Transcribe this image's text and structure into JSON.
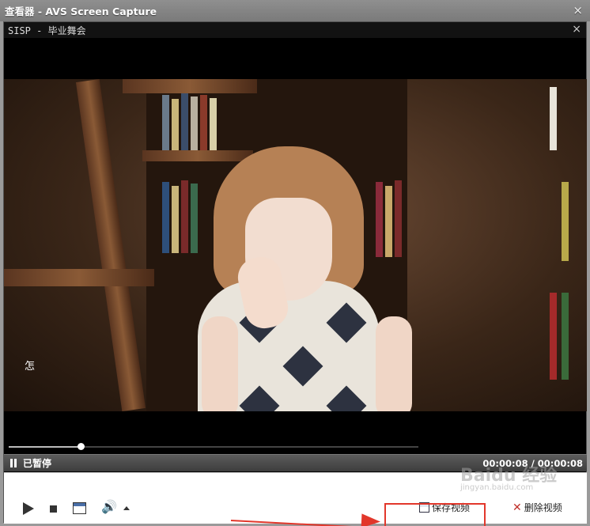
{
  "window": {
    "title": "查看器 - AVS Screen Capture",
    "close_glyph": "×"
  },
  "viewer": {
    "title": "SISP - 毕业舞会",
    "close_glyph": "×"
  },
  "video": {
    "subtitle": "怎"
  },
  "playback": {
    "progress": 0.175
  },
  "status": {
    "state": "已暂停",
    "time": "00:00:08 / 00:00:08"
  },
  "controls": {
    "save_label": "保存视频",
    "delete_label": "删除视频",
    "delete_glyph": "✕"
  },
  "watermark": {
    "text": "Baidu 经验",
    "sub": "jingyan.baidu.com"
  },
  "colors": {
    "annotation": "#e2372b"
  }
}
